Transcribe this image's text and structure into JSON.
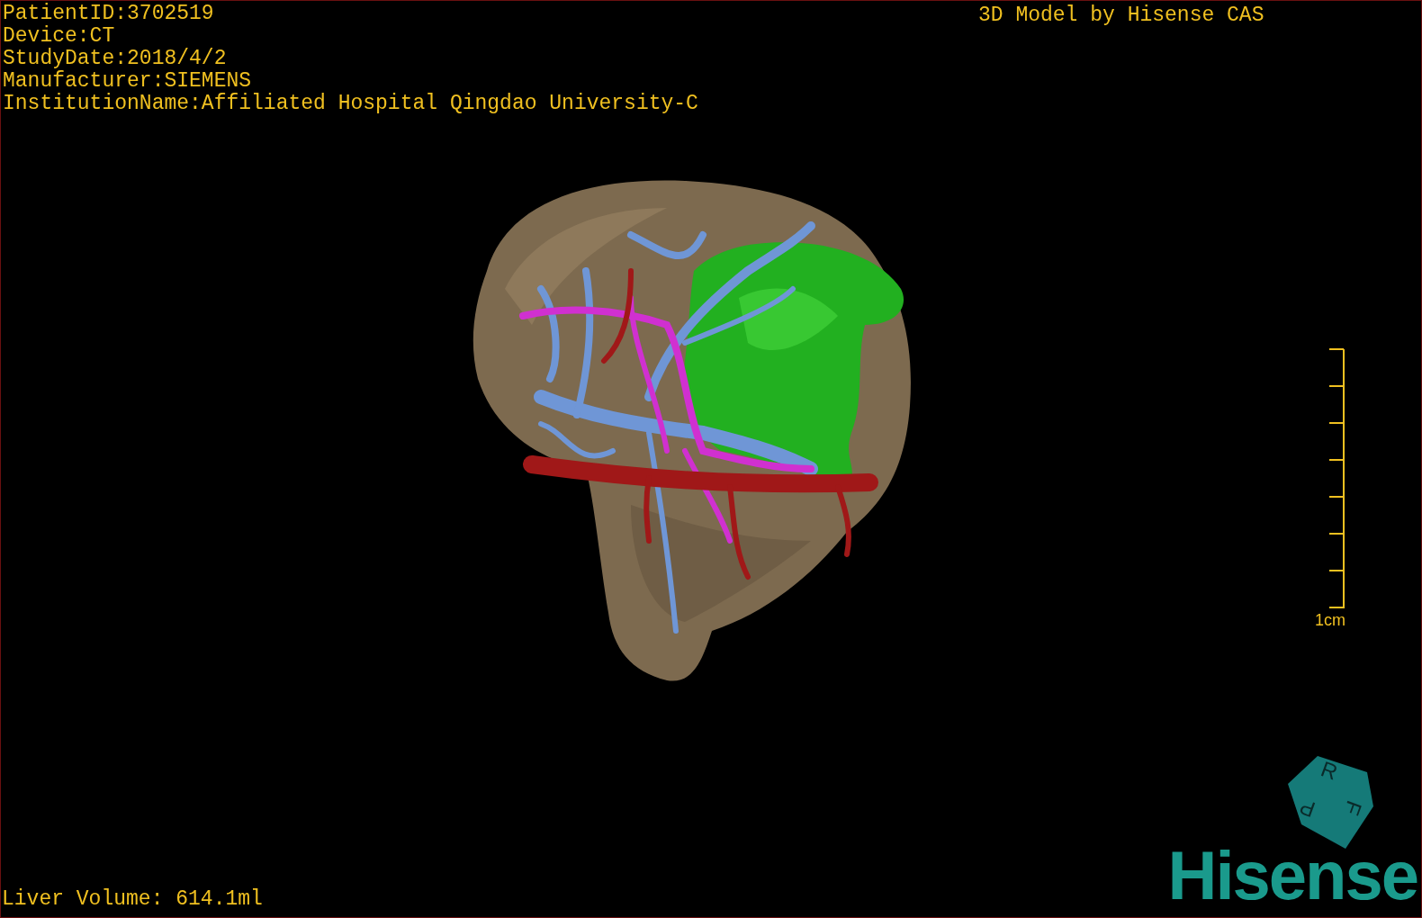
{
  "info_lines": [
    "PatientID:3702519",
    "Device:CT",
    "StudyDate:2018/4/2",
    "Manufacturer:SIEMENS",
    "InstitutionName:Affiliated Hospital Qingdao University-C"
  ],
  "title": "3D Model by Hisense CAS",
  "scale_bar": {
    "label": "1cm"
  },
  "orientation_cube": {
    "faces": [
      "R",
      "F",
      "P"
    ]
  },
  "logo": "Hisense",
  "liver_volume": "Liver Volume: 614.1ml"
}
